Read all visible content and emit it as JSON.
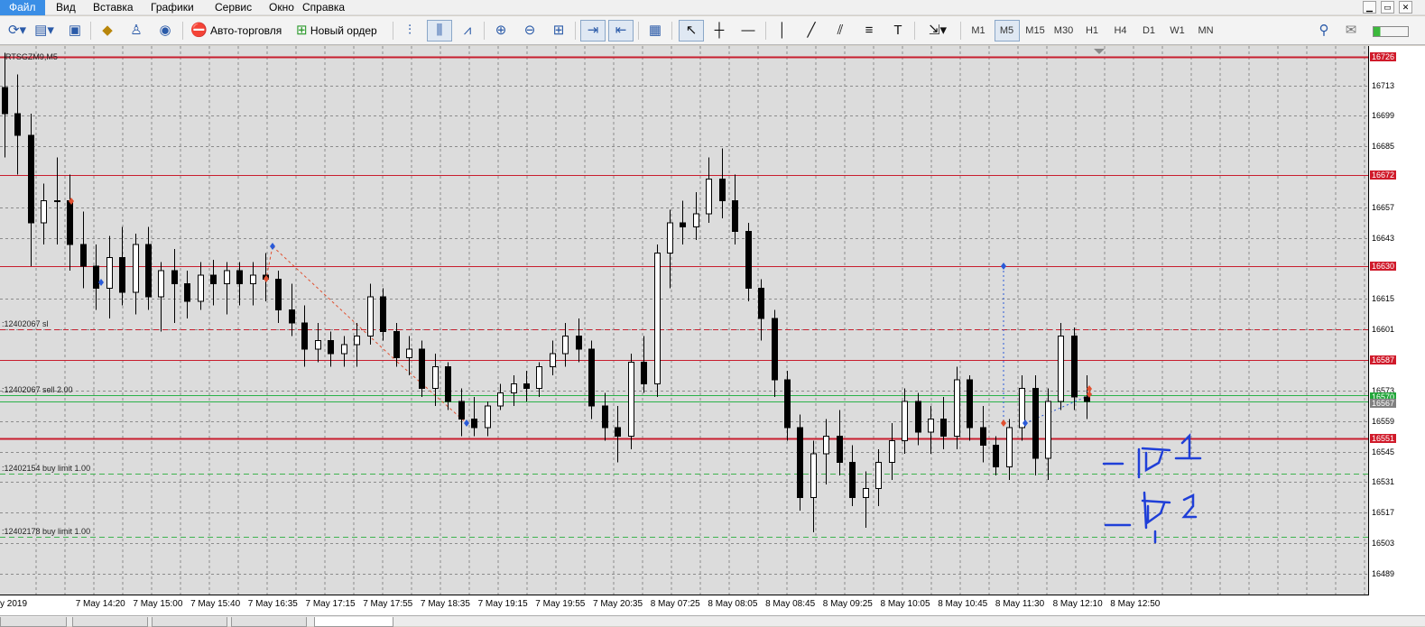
{
  "menu": {
    "items": [
      "Файл",
      "Вид",
      "Вставка",
      "Графики",
      "Сервис",
      "Окно",
      "Справка"
    ],
    "active_index": 0
  },
  "toolbar": {
    "autotrade_label": "Авто-торговля",
    "new_order_label": "Новый ордер",
    "timeframes": [
      "M1",
      "M5",
      "M15",
      "M30",
      "H1",
      "H4",
      "D1",
      "W1",
      "MN"
    ],
    "active_timeframe": "M5"
  },
  "chart": {
    "symbol_label": "RTSGZM9,M5",
    "price_scale": {
      "min": 16479,
      "max": 16731,
      "ticks": [
        16713,
        16699,
        16685,
        16672,
        16657,
        16643,
        16630,
        16615,
        16601,
        16587,
        16573,
        16559,
        16545,
        16531,
        16517,
        16503,
        16489
      ]
    },
    "price_highlights": [
      {
        "value": 16726,
        "label": "16726",
        "color": "#d01a2a"
      },
      {
        "value": 16672,
        "label": "16672",
        "color": "#d01a2a"
      },
      {
        "value": 16630,
        "label": "16630",
        "color": "#d01a2a"
      },
      {
        "value": 16587,
        "label": "16587",
        "color": "#d01a2a"
      },
      {
        "value": 16570,
        "label": "16570",
        "color": "#22a63a"
      },
      {
        "value": 16567,
        "label": "16567",
        "color": "#808080"
      },
      {
        "value": 16551,
        "label": "16551",
        "color": "#d01a2a"
      }
    ],
    "horizontal_lines": [
      {
        "value": 16726,
        "color": "#c81e2e",
        "style": "solid",
        "width": 2
      },
      {
        "value": 16672,
        "color": "#c81e2e",
        "style": "solid",
        "width": 1
      },
      {
        "value": 16630,
        "color": "#c81e2e",
        "style": "solid",
        "width": 1
      },
      {
        "value": 16601,
        "color": "#c81e2e",
        "style": "dashed",
        "width": 1
      },
      {
        "value": 16587,
        "color": "#c81e2e",
        "style": "solid",
        "width": 1
      },
      {
        "value": 16571,
        "color": "#2bb24a",
        "style": "solid",
        "width": 1
      },
      {
        "value": 16568,
        "color": "#2bb24a",
        "style": "solid",
        "width": 1
      },
      {
        "value": 16551,
        "color": "#c81e2e",
        "style": "solid",
        "width": 2
      },
      {
        "value": 16535,
        "color": "#3fb34f",
        "style": "dashed",
        "width": 1
      },
      {
        "value": 16506,
        "color": "#3fb34f",
        "style": "dashed",
        "width": 1
      }
    ],
    "order_labels": [
      {
        "text": ":12402067 sl",
        "value": 16601
      },
      {
        "text": ":12402067 sell 2.00",
        "value": 16571
      },
      {
        "text": ":12402154 buy limit 1.00",
        "value": 16535
      },
      {
        "text": ":12402178 buy limit 1.00",
        "value": 16506
      }
    ],
    "time_labels": [
      "y 2019",
      "7 May 14:20",
      "7 May 15:00",
      "7 May 15:40",
      "7 May 16:35",
      "7 May 17:15",
      "7 May 17:55",
      "7 May 18:35",
      "7 May 19:15",
      "7 May 19:55",
      "7 May 20:35",
      "8 May 07:25",
      "8 May 08:05",
      "8 May 08:45",
      "8 May 09:25",
      "8 May 10:05",
      "8 May 10:45",
      "8 May 11:30",
      "8 May 12:10",
      "8 May 12:50"
    ],
    "annotations": [
      "Тр 1",
      "Тр 2"
    ]
  },
  "chart_data": {
    "type": "candlestick",
    "title": "RTSGZM9,M5",
    "ylim": [
      16479,
      16731
    ],
    "candles": [
      [
        16712,
        16728,
        16680,
        16700
      ],
      [
        16700,
        16718,
        16672,
        16690
      ],
      [
        16690,
        16700,
        16630,
        16650
      ],
      [
        16650,
        16668,
        16640,
        16660
      ],
      [
        16660,
        16680,
        16640,
        16660
      ],
      [
        16660,
        16672,
        16628,
        16640
      ],
      [
        16640,
        16655,
        16620,
        16630
      ],
      [
        16630,
        16640,
        16610,
        16620
      ],
      [
        16620,
        16644,
        16606,
        16634
      ],
      [
        16634,
        16648,
        16612,
        16618
      ],
      [
        16618,
        16645,
        16608,
        16640
      ],
      [
        16640,
        16648,
        16610,
        16616
      ],
      [
        16616,
        16632,
        16600,
        16628
      ],
      [
        16628,
        16638,
        16604,
        16622
      ],
      [
        16622,
        16628,
        16606,
        16614
      ],
      [
        16614,
        16632,
        16610,
        16626
      ],
      [
        16626,
        16633,
        16612,
        16622
      ],
      [
        16622,
        16632,
        16608,
        16628
      ],
      [
        16628,
        16632,
        16612,
        16622
      ],
      [
        16622,
        16632,
        16612,
        16626
      ],
      [
        16626,
        16636,
        16614,
        16624
      ],
      [
        16624,
        16628,
        16604,
        16610
      ],
      [
        16610,
        16622,
        16598,
        16604
      ],
      [
        16604,
        16612,
        16584,
        16592
      ],
      [
        16592,
        16604,
        16586,
        16596
      ],
      [
        16596,
        16600,
        16584,
        16590
      ],
      [
        16590,
        16598,
        16584,
        16594
      ],
      [
        16594,
        16604,
        16584,
        16598
      ],
      [
        16598,
        16622,
        16594,
        16616
      ],
      [
        16616,
        16620,
        16596,
        16600
      ],
      [
        16600,
        16604,
        16584,
        16588
      ],
      [
        16588,
        16598,
        16580,
        16592
      ],
      [
        16592,
        16596,
        16570,
        16574
      ],
      [
        16574,
        16590,
        16566,
        16584
      ],
      [
        16584,
        16586,
        16564,
        16568
      ],
      [
        16568,
        16574,
        16552,
        16560
      ],
      [
        16560,
        16570,
        16552,
        16556
      ],
      [
        16556,
        16568,
        16552,
        16566
      ],
      [
        16566,
        16576,
        16564,
        16572
      ],
      [
        16572,
        16580,
        16566,
        16576
      ],
      [
        16576,
        16582,
        16568,
        16574
      ],
      [
        16574,
        16586,
        16570,
        16584
      ],
      [
        16584,
        16596,
        16580,
        16590
      ],
      [
        16590,
        16604,
        16584,
        16598
      ],
      [
        16598,
        16606,
        16586,
        16592
      ],
      [
        16592,
        16596,
        16560,
        16566
      ],
      [
        16566,
        16572,
        16550,
        16556
      ],
      [
        16556,
        16566,
        16540,
        16552
      ],
      [
        16552,
        16590,
        16546,
        16586
      ],
      [
        16586,
        16598,
        16572,
        16576
      ],
      [
        16576,
        16640,
        16570,
        16636
      ],
      [
        16636,
        16656,
        16620,
        16650
      ],
      [
        16650,
        16660,
        16640,
        16648
      ],
      [
        16648,
        16664,
        16642,
        16654
      ],
      [
        16654,
        16680,
        16650,
        16670
      ],
      [
        16670,
        16684,
        16652,
        16660
      ],
      [
        16660,
        16672,
        16640,
        16646
      ],
      [
        16646,
        16650,
        16614,
        16620
      ],
      [
        16620,
        16624,
        16596,
        16606
      ],
      [
        16606,
        16610,
        16570,
        16578
      ],
      [
        16578,
        16582,
        16550,
        16556
      ],
      [
        16556,
        16562,
        16518,
        16524
      ],
      [
        16524,
        16550,
        16508,
        16544
      ],
      [
        16544,
        16560,
        16530,
        16552
      ],
      [
        16552,
        16564,
        16534,
        16540
      ],
      [
        16540,
        16548,
        16520,
        16524
      ],
      [
        16524,
        16536,
        16510,
        16528
      ],
      [
        16528,
        16546,
        16520,
        16540
      ],
      [
        16540,
        16558,
        16532,
        16550
      ],
      [
        16550,
        16574,
        16544,
        16568
      ],
      [
        16568,
        16572,
        16548,
        16554
      ],
      [
        16554,
        16566,
        16544,
        16560
      ],
      [
        16560,
        16570,
        16546,
        16552
      ],
      [
        16552,
        16584,
        16546,
        16578
      ],
      [
        16578,
        16580,
        16550,
        16556
      ],
      [
        16556,
        16566,
        16540,
        16548
      ],
      [
        16548,
        16552,
        16534,
        16538
      ],
      [
        16538,
        16560,
        16532,
        16556
      ],
      [
        16556,
        16580,
        16550,
        16574
      ],
      [
        16574,
        16580,
        16534,
        16542
      ],
      [
        16542,
        16574,
        16532,
        16568
      ],
      [
        16568,
        16604,
        16564,
        16598
      ],
      [
        16598,
        16602,
        16564,
        16570
      ],
      [
        16570,
        16580,
        16560,
        16568
      ]
    ]
  }
}
